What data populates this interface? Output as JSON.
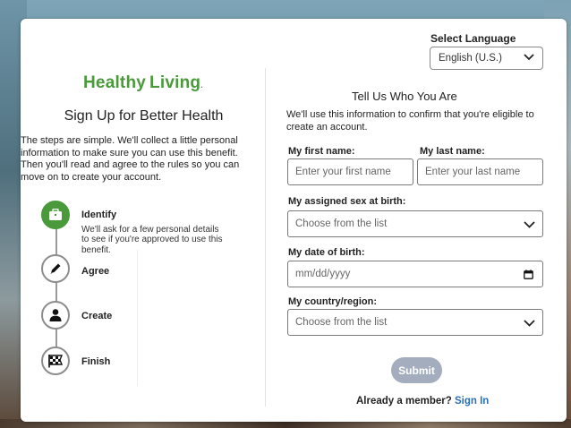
{
  "language": {
    "label": "Select Language",
    "selected": "English (U.S.)"
  },
  "brand": {
    "name_part1": "Healthy",
    "name_part2": "Living",
    "name_dot": ".",
    "color": "#4a9a3c"
  },
  "left": {
    "title": "Sign Up for Better Health",
    "intro": "The steps are simple. We'll collect a little personal information to make sure you can use this benefit. Then you'll read and agree to the rules so you can move on to create your account."
  },
  "steps": [
    {
      "label": "Identify",
      "icon": "briefcase-icon",
      "active": true,
      "description": "We'll ask for a few personal details to see if you're approved to use this benefit."
    },
    {
      "label": "Agree",
      "icon": "pencil-icon",
      "active": false
    },
    {
      "label": "Create",
      "icon": "person-icon",
      "active": false
    },
    {
      "label": "Finish",
      "icon": "checkered-flag-icon",
      "active": false
    }
  ],
  "form": {
    "title": "Tell Us Who You Are",
    "intro": "We'll use this information to confirm that you're eligible to create an account.",
    "first_name": {
      "label": "My first name:",
      "placeholder": "Enter your first name"
    },
    "last_name": {
      "label": "My last name:",
      "placeholder": "Enter your last name"
    },
    "sex": {
      "label": "My assigned sex at birth:",
      "placeholder": "Choose from the list"
    },
    "dob": {
      "label": "My date of birth:",
      "placeholder": "mm/dd/yyyy"
    },
    "country": {
      "label": "My country/region:",
      "placeholder": "Choose from the list"
    },
    "submit_label": "Submit",
    "member_text": "Already a member?",
    "sign_in_label": "Sign In"
  }
}
